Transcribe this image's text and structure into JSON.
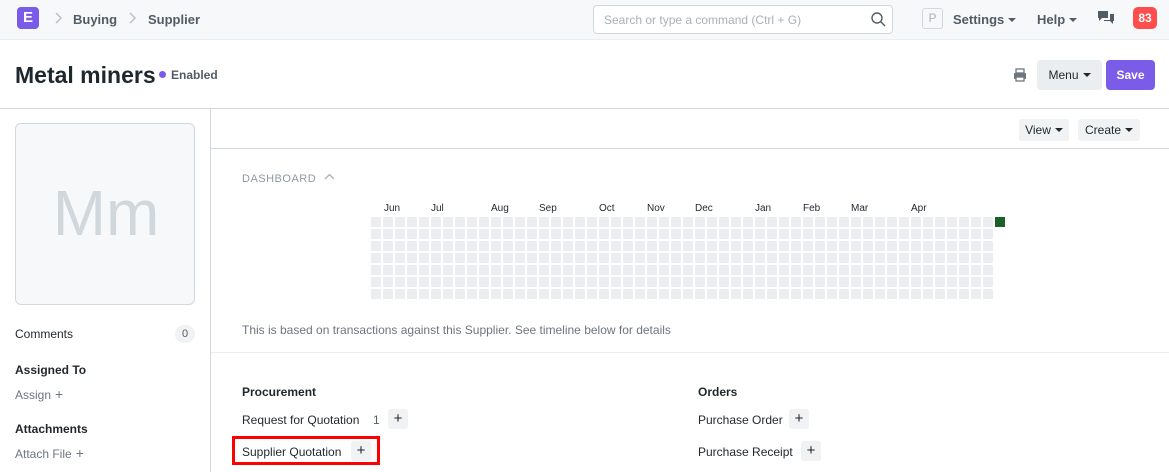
{
  "navbar": {
    "logo": "E",
    "breadcrumbs": [
      "Buying",
      "Supplier"
    ],
    "search_placeholder": "Search or type a command (Ctrl + G)",
    "avatar_initial": "P",
    "settings_label": "Settings",
    "help_label": "Help",
    "notifications_count": "83"
  },
  "page_head": {
    "title": "Metal miners",
    "status": "Enabled",
    "menu_label": "Menu",
    "save_label": "Save"
  },
  "sidebar": {
    "image_initials": "Mm",
    "comments_label": "Comments",
    "comments_count": "0",
    "assigned_to_label": "Assigned To",
    "assign_label": "Assign",
    "attachments_label": "Attachments",
    "attach_file_label": "Attach File"
  },
  "toolbar": {
    "view_label": "View",
    "create_label": "Create"
  },
  "dashboard": {
    "label": "DASHBOARD",
    "months": [
      "Jun",
      "Jul",
      "Aug",
      "Sep",
      "Oct",
      "Nov",
      "Dec",
      "Jan",
      "Feb",
      "Mar",
      "Apr"
    ],
    "info": "This is based on transactions against this Supplier. See timeline below for details",
    "empty_color": "#ebedf0",
    "active_color": "#196127"
  },
  "links": {
    "procurement": {
      "heading": "Procurement",
      "items": [
        {
          "label": "Request for Quotation",
          "count": "1"
        },
        {
          "label": "Supplier Quotation",
          "count": ""
        }
      ]
    },
    "orders": {
      "heading": "Orders",
      "items": [
        {
          "label": "Purchase Order",
          "count": ""
        },
        {
          "label": "Purchase Receipt",
          "count": ""
        }
      ]
    }
  },
  "colors": {
    "accent": "#7a5ce9",
    "notification": "#ff4d4d",
    "highlight": "#ff0000"
  }
}
